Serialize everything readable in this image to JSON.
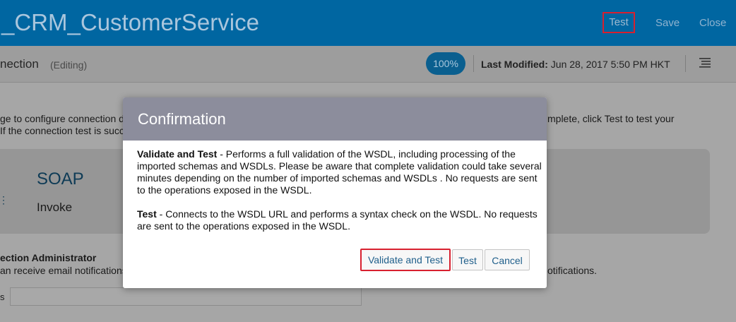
{
  "topbar": {
    "title": "_CRM_CustomerService",
    "buttons": {
      "test": "Test",
      "save": "Save",
      "close": "Close"
    }
  },
  "subheader": {
    "connection_title": "nection",
    "editing": "(Editing)",
    "percent": "100%",
    "last_modified_label": "Last Modified:",
    "last_modified_value": "Jun 28, 2017 5:50 PM HKT",
    "menu_icon": "hamburger-menu-icon"
  },
  "background": {
    "line1_left": "ge to configure connection d",
    "line1_right": "mplete, click Test to test your",
    "line2_left": "If the connection test is succ",
    "soap_title": "SOAP",
    "soap_subtitle": "Invoke",
    "admin_title": "ection Administrator",
    "admin_desc_left": "an receive email notifications",
    "admin_desc_right": "otifications.",
    "field_label": "s"
  },
  "modal": {
    "title": "Confirmation",
    "para1_bold": "Validate and Test",
    "para1_text": " - Performs a full validation of the WSDL, including processing of the imported schemas and WSDLs. Please be aware that complete validation could take several minutes depending on the number of imported schemas and WSDLs . No requests are sent to the operations exposed in the WSDL.",
    "para2_bold": "Test",
    "para2_text": " - Connects to the WSDL URL and performs a syntax check on the WSDL. No requests are sent to the operations exposed in the WSDL.",
    "buttons": {
      "validate_and_test": "Validate and Test",
      "test": "Test",
      "cancel": "Cancel"
    }
  },
  "colors": {
    "topbar": "#0066a1",
    "modal_header": "#8c8d9c",
    "highlight_border": "#d8202f",
    "link_text": "#1f5f8b"
  }
}
